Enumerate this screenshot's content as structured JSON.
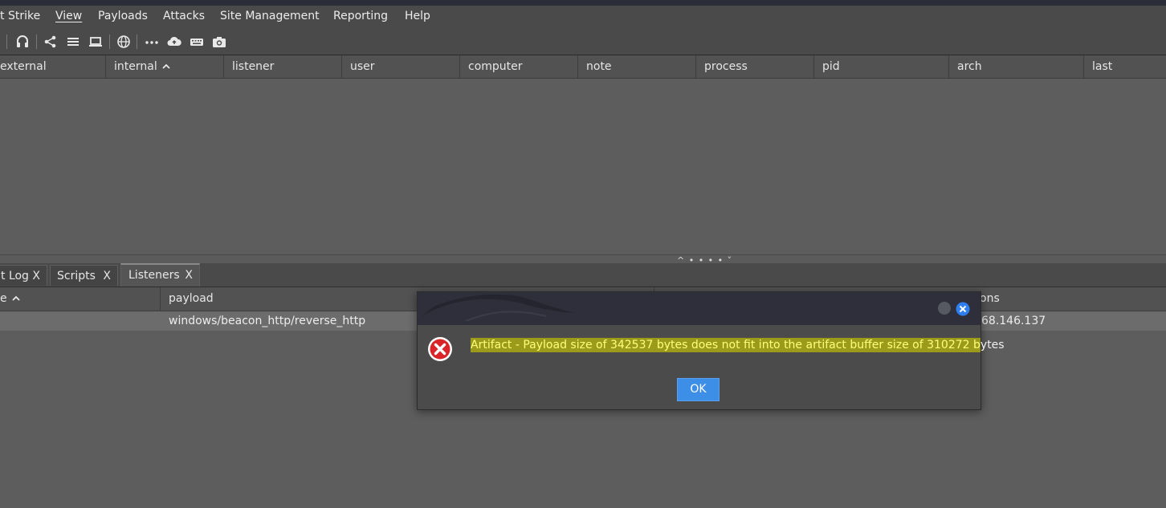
{
  "menubar": {
    "items": [
      "t Strike",
      "View",
      "Payloads",
      "Attacks",
      "Site Management",
      "Reporting",
      "Help"
    ]
  },
  "toolbar": {
    "icons": [
      "headset-icon",
      "share-icon",
      "list-icon",
      "laptop-icon",
      "globe-icon",
      "more-icon",
      "cloud-upload-icon",
      "keyboard-icon",
      "camera-icon"
    ]
  },
  "sessions_table": {
    "columns": [
      "external",
      "internal",
      "listener",
      "user",
      "computer",
      "note",
      "process",
      "pid",
      "arch",
      "last"
    ],
    "sorted_column": "internal"
  },
  "tabs": [
    {
      "label": "t Log",
      "close": "X"
    },
    {
      "label": "Scripts",
      "close": "X"
    },
    {
      "label": "Listeners",
      "close": "X",
      "active": true
    }
  ],
  "listeners_table": {
    "columns": [
      "e",
      "payload",
      "ons"
    ],
    "rows": [
      {
        "payload": "windows/beacon_http/reverse_http",
        "hosts": "68.146.137"
      }
    ]
  },
  "dialog": {
    "message_highlighted": "Artifact - Payload size of 342537 bytes does not fit into the artifact buffer size of 310272 b",
    "message_rest": "ytes",
    "ok_label": "OK"
  },
  "colors": {
    "accent": "#3d8ee6",
    "error_red": "#d9252a",
    "highlight": "#9c9a1b"
  }
}
